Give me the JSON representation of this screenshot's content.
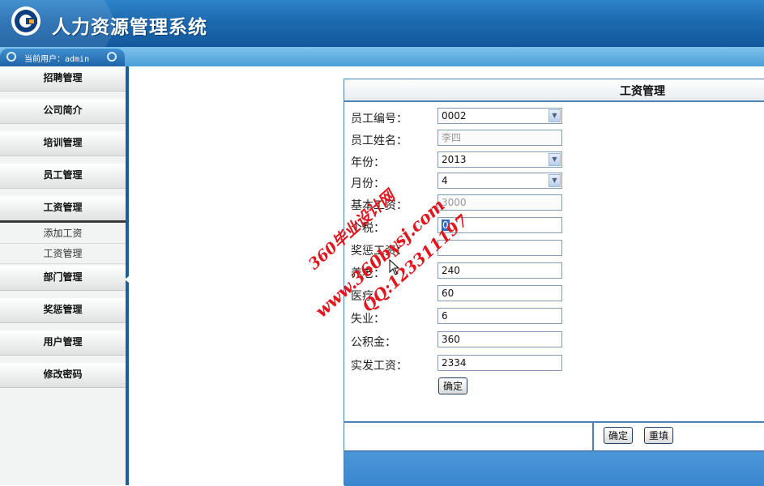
{
  "app": {
    "title": "人力资源管理系统"
  },
  "userbar": {
    "current_user": "当前用户：admin"
  },
  "sidebar": {
    "menus": [
      {
        "label": "招聘管理"
      },
      {
        "label": "公司简介"
      },
      {
        "label": "培训管理"
      },
      {
        "label": "员工管理"
      },
      {
        "label": "工资管理",
        "expanded": true,
        "items": [
          {
            "label": "添加工资"
          },
          {
            "label": "工资管理"
          }
        ]
      },
      {
        "label": "部门管理"
      },
      {
        "label": "奖惩管理"
      },
      {
        "label": "用户管理"
      },
      {
        "label": "修改密码"
      }
    ]
  },
  "panel": {
    "title": "工资管理",
    "fields": [
      {
        "label": "员工编号：",
        "value": "0002",
        "type": "select"
      },
      {
        "label": "员工姓名：",
        "value": "李四",
        "type": "text",
        "disabled": true
      },
      {
        "label": "年份：",
        "value": "2013",
        "type": "select"
      },
      {
        "label": "月份：",
        "value": "4",
        "type": "select"
      },
      {
        "label": "基本工资：",
        "value": "3000",
        "type": "text",
        "disabled": true
      },
      {
        "label": "个税：",
        "value": "0",
        "type": "text",
        "selected": true
      },
      {
        "label": "奖惩工资：",
        "value": "",
        "type": "text"
      },
      {
        "label": "养老：",
        "value": "240",
        "type": "text"
      },
      {
        "label": "医疗：",
        "value": "60",
        "type": "text"
      },
      {
        "label": "失业：",
        "value": "6",
        "type": "text"
      },
      {
        "label": "公积金：",
        "value": "360",
        "type": "text"
      },
      {
        "label": "实发工资：",
        "value": "2334",
        "type": "text"
      }
    ],
    "calc_button": "确定",
    "submit_button": "确定",
    "reset_button": "重填"
  },
  "watermark": {
    "line1": "360毕业设计网",
    "line2": "www.360bysj.com",
    "line3": "QQ:123311197"
  },
  "colors": {
    "header": "#1d69b0",
    "sidebar_border": "#1c5f96",
    "panel_border": "#4b82b8",
    "watermark": "#e2161c"
  }
}
